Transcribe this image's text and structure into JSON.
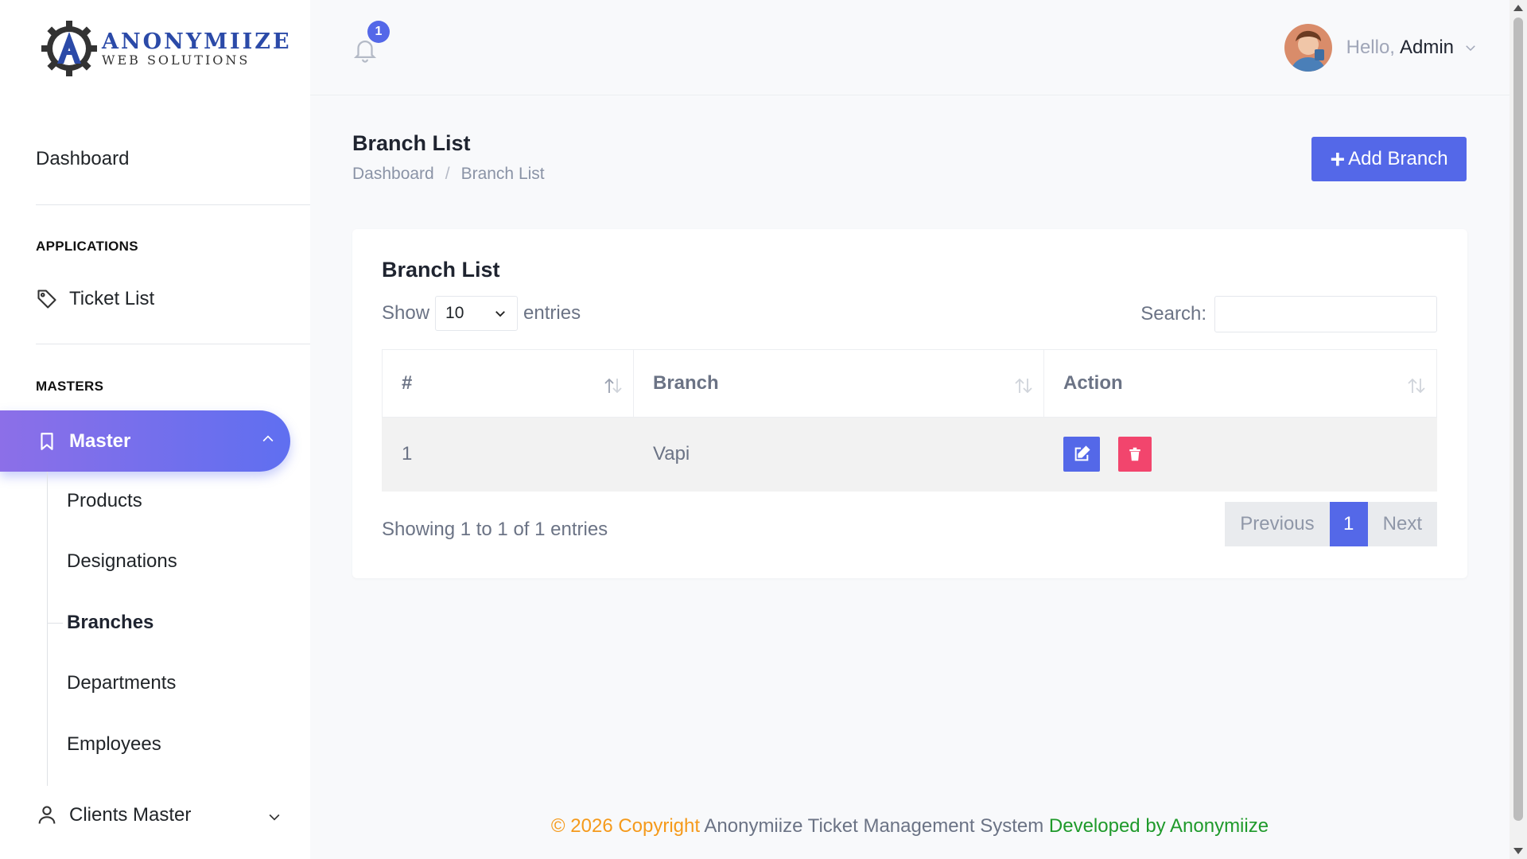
{
  "brand": {
    "name_line1": "Anonymiize",
    "name_line2": "Web Solutions",
    "accent_color": "#5468e8"
  },
  "sidebar": {
    "dashboard_label": "Dashboard",
    "sections": [
      {
        "title": "APPLICATIONS"
      },
      {
        "title": "MASTERS"
      }
    ],
    "ticket_list_label": "Ticket List",
    "master_label": "Master",
    "master_sub_items": [
      {
        "label": "Products"
      },
      {
        "label": "Designations"
      },
      {
        "label": "Branches",
        "active": true
      },
      {
        "label": "Departments"
      },
      {
        "label": "Employees"
      }
    ],
    "clients_master_label": "Clients Master"
  },
  "header": {
    "notification_count": "1",
    "greeting": "Hello,",
    "user_name": "Admin"
  },
  "page": {
    "title": "Branch List",
    "breadcrumb": [
      "Dashboard",
      "Branch List"
    ],
    "add_button_label": "Add Branch"
  },
  "card": {
    "title": "Branch List",
    "show_label": "Show",
    "entries_label": "entries",
    "page_size": "10",
    "search_label": "Search:",
    "search_value": "",
    "columns": [
      "#",
      "Branch",
      "Action"
    ],
    "rows": [
      {
        "index": "1",
        "branch": "Vapi"
      }
    ],
    "info_text": "Showing 1 to 1 of 1 entries",
    "pagination": {
      "previous": "Previous",
      "current": "1",
      "next": "Next"
    }
  },
  "footer": {
    "copyright": "© 2026 Copyright",
    "system_name": "Anonymiize Ticket Management System",
    "developed_by": "Developed by Anonymiize"
  }
}
